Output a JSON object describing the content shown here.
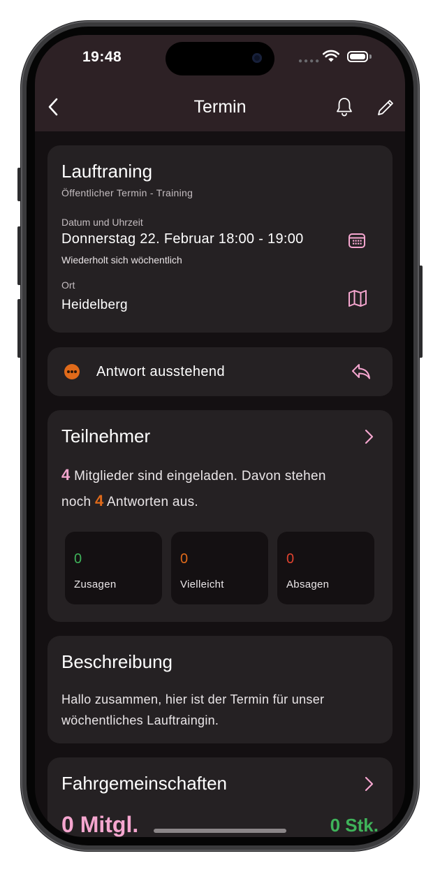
{
  "status_bar": {
    "time": "19:48"
  },
  "nav": {
    "title": "Termin",
    "back_icon": "chevron-left-icon",
    "bell_icon": "bell-icon",
    "edit_icon": "pencil-icon"
  },
  "event": {
    "title": "Lauftraning",
    "subtitle": "Öffentlicher Termin - Training",
    "datetime_label": "Datum und Uhrzeit",
    "datetime": "Donnerstag 22. Februar 18:00 - 19:00",
    "repeat": "Wiederholt sich wöchentlich",
    "location_label": "Ort",
    "location": "Heidelberg"
  },
  "response": {
    "status": "Antwort ausstehend"
  },
  "participants": {
    "title": "Teilnehmer",
    "invited_count": "4",
    "text_part1": " Mitglieder sind eingeladen. Davon stehen",
    "text_part2_prefix": "noch ",
    "pending_count": "4",
    "text_part3": " Antworten aus.",
    "stats": [
      {
        "value": "0",
        "label": "Zusagen"
      },
      {
        "value": "0",
        "label": "Vielleicht"
      },
      {
        "value": "0",
        "label": "Absagen"
      }
    ]
  },
  "description": {
    "title": "Beschreibung",
    "text": "Hallo zusammen, hier ist der Termin für unser wöchentliches Lauftraingin."
  },
  "carpools": {
    "title": "Fahrgemeinschaften",
    "members": "0 Mitgl.",
    "pieces": "0 Stk."
  },
  "colors": {
    "accent_pink": "#f5a6cf",
    "pending_orange": "#e06a1a",
    "yes_green": "#3fb35a",
    "no_red": "#e0432f",
    "card_bg": "#252123",
    "header_bg": "#2d2125"
  }
}
